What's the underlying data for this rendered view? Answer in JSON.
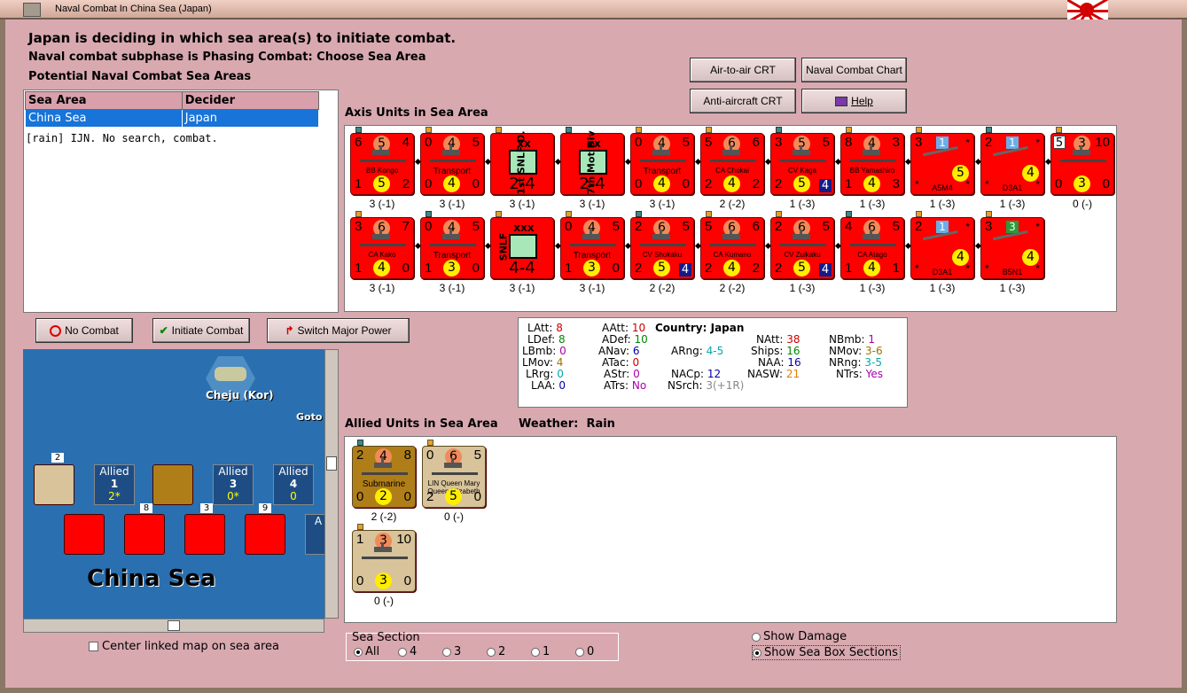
{
  "window": {
    "title": "Naval Combat In China Sea (Japan)"
  },
  "header": {
    "line1": "Japan is deciding in which sea area(s) to initiate combat.",
    "line2": "Naval combat subphase is Phasing Combat: Choose Sea Area",
    "line3": "Potential Naval Combat Sea Areas"
  },
  "sea_table": {
    "col1": "Sea Area",
    "col2": "Decider",
    "rows": [
      {
        "area": "China Sea",
        "decider": "Japan"
      }
    ],
    "note": "[rain]  IJN.  No search, combat."
  },
  "buttons": {
    "air_to_air": "Air-to-air CRT",
    "naval_chart": "Naval Combat Chart",
    "anti_aircraft": "Anti-aircraft CRT",
    "help": "Help",
    "no_combat": "No Combat",
    "initiate": "Initiate Combat",
    "switch": "Switch Major Power"
  },
  "axis_label": "Axis Units in Sea Area",
  "axis_units": [
    {
      "a": "6",
      "c": "5",
      "b": "4",
      "bl": "1",
      "y": "5",
      "br": "2",
      "name": "BB Kongo",
      "cap": "3 (-1)"
    },
    {
      "a": "0",
      "c": "4",
      "b": "5",
      "bl": "0",
      "y": "4",
      "br": "0",
      "name": "Transport",
      "cap": "3 (-1)"
    },
    {
      "kind": "land",
      "v": "1st SNLF D.",
      "x": "xx",
      "val": "2-4",
      "cap": "3 (-1)"
    },
    {
      "kind": "land",
      "v": "7th Mot Div",
      "x": "xx",
      "val": "2-4",
      "cap": "3 (-1)"
    },
    {
      "a": "0",
      "c": "4",
      "b": "5",
      "bl": "0",
      "y": "4",
      "br": "0",
      "name": "Transport",
      "cap": "3 (-1)"
    },
    {
      "a": "5",
      "c": "6",
      "b": "6",
      "bl": "2",
      "y": "4",
      "br": "2",
      "name": "CA Chokai",
      "cap": "2 (-2)"
    },
    {
      "a": "3",
      "c": "5",
      "b": "5",
      "bl": "2",
      "y": "5",
      "br": "4",
      "name": "CV Kaga",
      "cap": "1 (-3)",
      "blue": true
    },
    {
      "a": "8",
      "c": "4",
      "b": "3",
      "bl": "1",
      "y": "4",
      "br": "3",
      "name": "BB Yamashiro",
      "cap": "1 (-3)"
    },
    {
      "kind": "air",
      "a": "3",
      "sq": "1",
      "b": "*",
      "bl": "*",
      "y": "5",
      "br": "*",
      "name": "A5M4",
      "cap": "1 (-3)"
    },
    {
      "kind": "air",
      "a": "2",
      "sq": "1",
      "b": "*",
      "bl": "*",
      "y": "4",
      "br": "*",
      "name": "D3A1",
      "cap": "1 (-3)"
    },
    {
      "a": "5",
      "c": "3",
      "b": "10",
      "bl": "0",
      "y": "3",
      "br": "0",
      "name": "",
      "cap": "0 (-)",
      "white": true
    },
    {
      "a": "3",
      "c": "6",
      "b": "7",
      "bl": "1",
      "y": "4",
      "br": "0",
      "name": "CA Kako",
      "cap": "3 (-1)"
    },
    {
      "a": "0",
      "c": "4",
      "b": "5",
      "bl": "1",
      "y": "3",
      "br": "0",
      "name": "Transport",
      "cap": "3 (-1)"
    },
    {
      "kind": "land",
      "v": "SNLF",
      "x": "xxx",
      "val": "4-4",
      "cap": "3 (-1)"
    },
    {
      "a": "0",
      "c": "4",
      "b": "5",
      "bl": "1",
      "y": "3",
      "br": "0",
      "name": "Transport",
      "cap": "3 (-1)"
    },
    {
      "a": "2",
      "c": "6",
      "b": "5",
      "bl": "2",
      "y": "5",
      "br": "4",
      "name": "CV Shokaku",
      "cap": "2 (-2)",
      "blue": true
    },
    {
      "a": "5",
      "c": "6",
      "b": "6",
      "bl": "2",
      "y": "4",
      "br": "2",
      "name": "CA Kumano",
      "cap": "2 (-2)"
    },
    {
      "a": "2",
      "c": "6",
      "b": "5",
      "bl": "2",
      "y": "5",
      "br": "4",
      "name": "CV Zuikaku",
      "cap": "1 (-3)",
      "blue": true
    },
    {
      "a": "4",
      "c": "6",
      "b": "5",
      "bl": "1",
      "y": "4",
      "br": "1",
      "name": "CA Atago",
      "cap": "1 (-3)"
    },
    {
      "kind": "air",
      "a": "2",
      "sq": "1",
      "b": "*",
      "bl": "*",
      "y": "4",
      "br": "*",
      "name": "D3A1",
      "cap": "1 (-3)"
    },
    {
      "kind": "air",
      "a": "3",
      "sq": "3",
      "b": "*",
      "bl": "*",
      "y": "4",
      "br": "*",
      "name": "B5N1",
      "cap": "1 (-3)",
      "green": true
    }
  ],
  "stats": {
    "country_label": "Country:",
    "country": "Japan",
    "LAtt": "8",
    "LDef": "8",
    "LBmb": "0",
    "LMov": "4",
    "LRrg": "0",
    "LAA": "0",
    "AAtt": "10",
    "ADef": "10",
    "ANav": "6",
    "ATac": "0",
    "AStr": "0",
    "ATrs": "No",
    "ARng": "4-5",
    "NACp": "12",
    "NSrch": "3(+1R)",
    "NAtt": "38",
    "Ships": "16",
    "NAA": "16",
    "NASW": "21",
    "NBmb": "1",
    "NMov": "3-6",
    "NRng": "3-5",
    "NTrs": "Yes"
  },
  "allied_label": "Allied Units in Sea Area",
  "weather_label": "Weather:",
  "weather": "Rain",
  "allied_units": [
    {
      "a": "2",
      "c": "4",
      "b": "8",
      "bl": "0",
      "y": "2",
      "br": "0",
      "name": "Submarine",
      "cap": "2 (-2)"
    },
    {
      "a": "0",
      "c": "6",
      "b": "5",
      "bl": "2",
      "y": "5",
      "br": "0",
      "name": "LIN Queen Mary Queen Elizabeth",
      "cap": "0 (-)"
    },
    {
      "a": "1",
      "c": "3",
      "b": "10",
      "bl": "0",
      "y": "3",
      "br": "0",
      "name": "",
      "cap": "0 (-)"
    }
  ],
  "map": {
    "place1": "Cheju (Kor)",
    "place2": "Goto",
    "sea_name": "China Sea",
    "boxes": [
      {
        "t": "Allied",
        "n": "1",
        "s": "2*"
      },
      {
        "t": "Allied",
        "n": "3",
        "s": "0*"
      },
      {
        "t": "Allied",
        "n": "4",
        "s": "0"
      }
    ],
    "stack_counts": [
      "2",
      "8",
      "3",
      "9"
    ],
    "partial": "A"
  },
  "center_map": "Center linked map on sea area",
  "sea_section": {
    "label": "Sea Section",
    "options": [
      "All",
      "4",
      "3",
      "2",
      "1",
      "0"
    ]
  },
  "show_damage": "Show Damage",
  "show_sections": "Show Sea Box Sections",
  "colors": {
    "counter_red": "#ff0000",
    "allied_tan": "#d8c39a",
    "selection": "#1874d8"
  }
}
